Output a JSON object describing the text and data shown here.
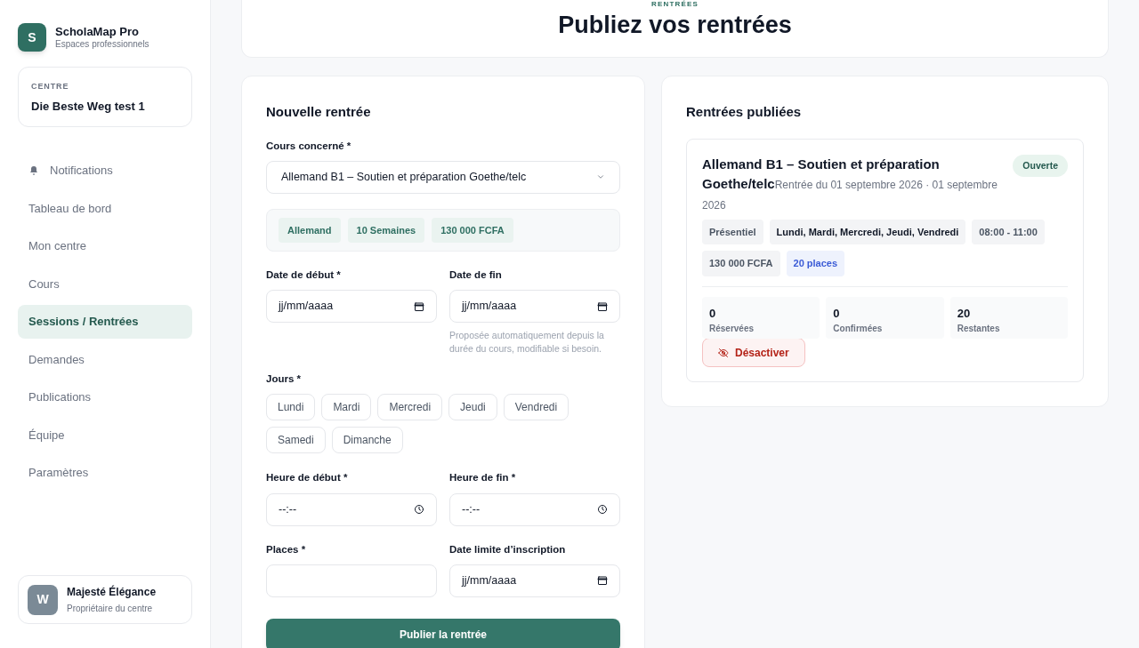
{
  "brand": {
    "initial": "S",
    "name": "ScholaMap Pro",
    "subtitle": "Espaces professionnels"
  },
  "centre": {
    "label": "CENTRE",
    "name": "Die Beste Weg test 1"
  },
  "nav": [
    {
      "label": "Notifications",
      "kind": "bell",
      "selected": false
    },
    {
      "label": "Tableau de bord",
      "kind": "plain",
      "selected": false
    },
    {
      "label": "Mon centre",
      "kind": "plain",
      "selected": false
    },
    {
      "label": "Cours",
      "kind": "plain",
      "selected": false
    },
    {
      "label": "Sessions / Rentrées",
      "kind": "plain",
      "selected": true
    },
    {
      "label": "Demandes",
      "kind": "plain",
      "selected": false
    },
    {
      "label": "Publications",
      "kind": "plain",
      "selected": false
    },
    {
      "label": "Équipe",
      "kind": "plain",
      "selected": false
    },
    {
      "label": "Paramètres",
      "kind": "plain",
      "selected": false
    }
  ],
  "user": {
    "initial": "W",
    "name": "Majesté Élégance",
    "role": "Propriétaire du centre"
  },
  "header": {
    "eyebrow": "RENTRÉES",
    "title": "Publiez vos rentrées"
  },
  "form": {
    "title": "Nouvelle rentrée",
    "course": {
      "label": "Cours concerné *",
      "value": "Allemand B1 – Soutien et préparation Goethe/telc"
    },
    "course_tags": [
      "Allemand",
      "10 Semaines",
      "130 000 FCFA"
    ],
    "start_date": {
      "label": "Date de début *",
      "placeholder": "jj/mm/aaaa"
    },
    "end_date": {
      "label": "Date de fin",
      "placeholder": "jj/mm/aaaa",
      "hint": "Proposée automatiquement depuis la durée du cours, modifiable si besoin."
    },
    "days_label": "Jours *",
    "days": [
      {
        "label": "Lundi",
        "selected": false
      },
      {
        "label": "Mardi",
        "selected": false
      },
      {
        "label": "Mercredi",
        "selected": false
      },
      {
        "label": "Jeudi",
        "selected": false
      },
      {
        "label": "Vendredi",
        "selected": false
      },
      {
        "label": "Samedi",
        "selected": false
      },
      {
        "label": "Dimanche",
        "selected": false
      }
    ],
    "start_time": {
      "label": "Heure de début *",
      "placeholder": "--:--"
    },
    "end_time": {
      "label": "Heure de fin *",
      "placeholder": "--:--"
    },
    "places": {
      "label": "Places *"
    },
    "deadline": {
      "label": "Date limite d’inscription",
      "placeholder": "jj/mm/aaaa"
    },
    "submit": "Publier la rentrée"
  },
  "published": {
    "title": "Rentrées publiées",
    "items": [
      {
        "title": "Allemand B1 – Soutien et préparation Goethe/telc",
        "dates": "Rentrée du 01 septembre 2026 · 01 septembre 2026",
        "status": "Ouverte",
        "tags": [
          {
            "label": "Présentiel",
            "kind": "muted"
          },
          {
            "label": "Lundi, Mardi, Mercredi, Jeudi, Vendredi",
            "kind": "strong"
          },
          {
            "label": "08:00 - 11:00",
            "kind": "muted"
          },
          {
            "label": "130 000 FCFA",
            "kind": "muted"
          },
          {
            "label": "20 places",
            "kind": "blue"
          }
        ],
        "stats": [
          {
            "value": "0",
            "label": "Réservées"
          },
          {
            "value": "0",
            "label": "Confirmées"
          },
          {
            "value": "20",
            "label": "Restantes"
          }
        ],
        "action": "Désactiver"
      }
    ]
  }
}
